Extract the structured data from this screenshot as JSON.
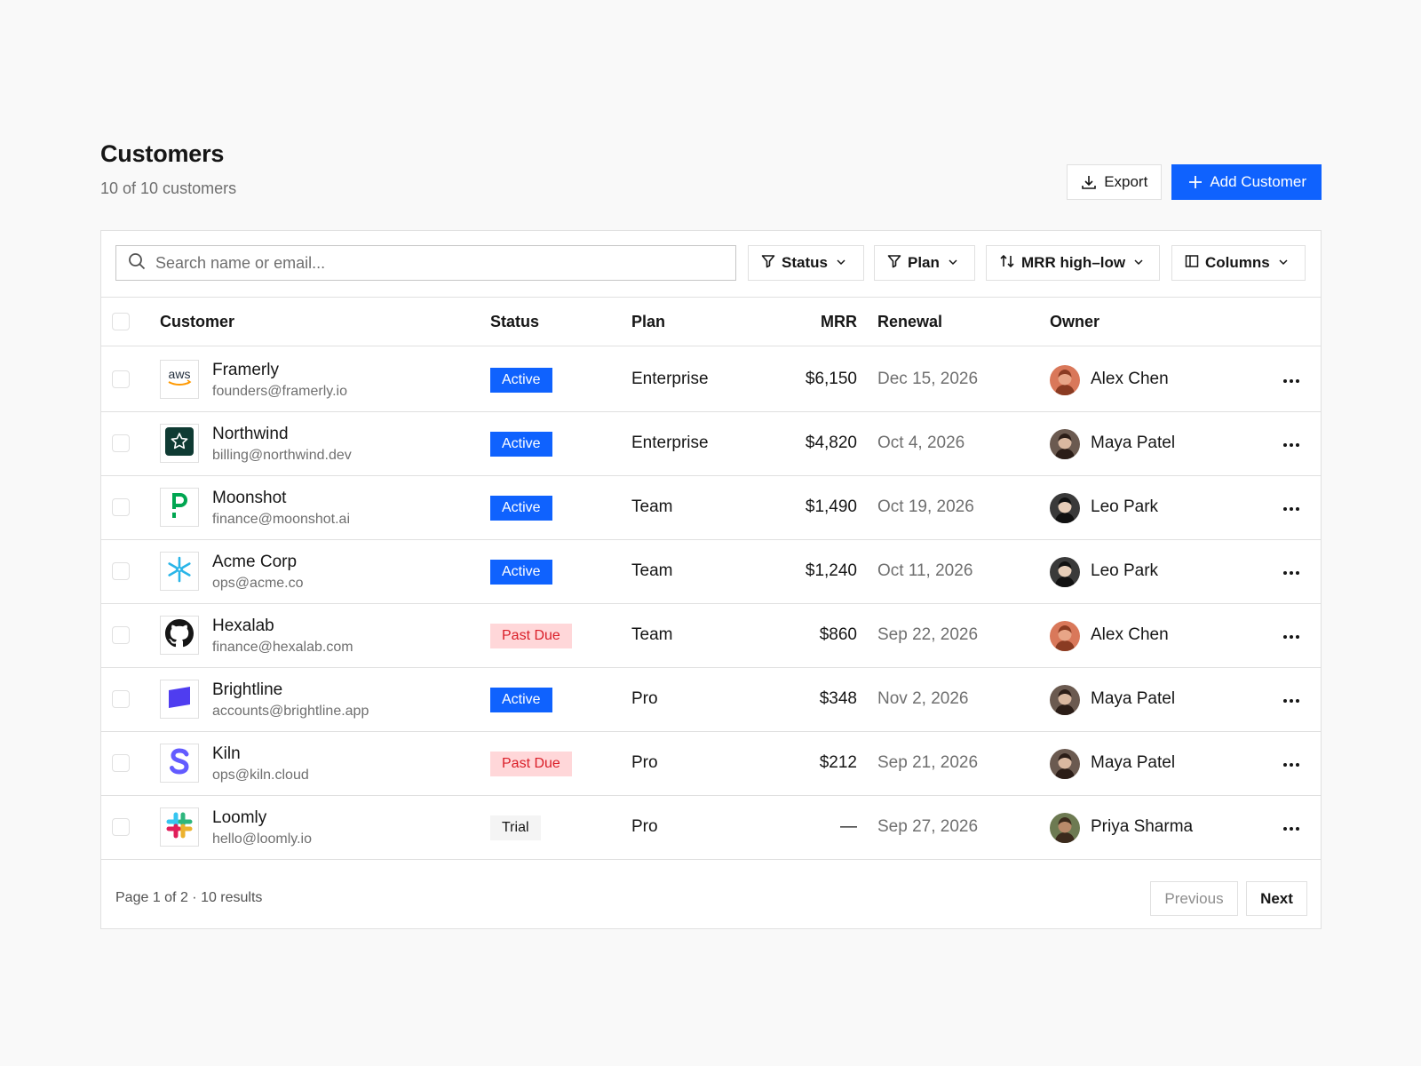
{
  "header": {
    "title": "Customers",
    "subtitle": "10 of 10 customers",
    "export_label": "Export",
    "add_label": "Add Customer"
  },
  "toolbar": {
    "search_placeholder": "Search name or email...",
    "filters": [
      {
        "label": "Status",
        "icon": "filter-icon"
      },
      {
        "label": "Plan",
        "icon": "filter-icon"
      },
      {
        "label": "MRR high–low",
        "icon": "sort-icon"
      },
      {
        "label": "Columns",
        "icon": "columns-icon"
      }
    ]
  },
  "table": {
    "columns": [
      "Customer",
      "Status",
      "Plan",
      "MRR",
      "Renewal",
      "Owner"
    ],
    "rows": [
      {
        "name": "Framerly",
        "email": "founders@framerly.io",
        "logo": "aws-logo",
        "status": "Active",
        "plan": "Enterprise",
        "mrr": "$6,150",
        "renewal": "Dec 15, 2026",
        "owner": "Alex Chen"
      },
      {
        "name": "Northwind",
        "email": "billing@northwind.dev",
        "logo": "star-logo",
        "status": "Active",
        "plan": "Enterprise",
        "mrr": "$4,820",
        "renewal": "Oct 4, 2026",
        "owner": "Maya Patel"
      },
      {
        "name": "Moonshot",
        "email": "finance@moonshot.ai",
        "logo": "p-logo",
        "status": "Active",
        "plan": "Team",
        "mrr": "$1,490",
        "renewal": "Oct 19, 2026",
        "owner": "Leo Park"
      },
      {
        "name": "Acme Corp",
        "email": "ops@acme.co",
        "logo": "snowflake-logo",
        "status": "Active",
        "plan": "Team",
        "mrr": "$1,240",
        "renewal": "Oct 11, 2026",
        "owner": "Leo Park"
      },
      {
        "name": "Hexalab",
        "email": "finance@hexalab.com",
        "logo": "github-logo",
        "status": "Past Due",
        "plan": "Team",
        "mrr": "$860",
        "renewal": "Sep 22, 2026",
        "owner": "Alex Chen"
      },
      {
        "name": "Brightline",
        "email": "accounts@brightline.app",
        "logo": "parallelogram-logo",
        "status": "Active",
        "plan": "Pro",
        "mrr": "$348",
        "renewal": "Nov 2, 2026",
        "owner": "Maya Patel"
      },
      {
        "name": "Kiln",
        "email": "ops@kiln.cloud",
        "logo": "s-logo",
        "status": "Past Due",
        "plan": "Pro",
        "mrr": "$212",
        "renewal": "Sep 21, 2026",
        "owner": "Maya Patel"
      },
      {
        "name": "Loomly",
        "email": "hello@loomly.io",
        "logo": "slack-logo",
        "status": "Trial",
        "plan": "Pro",
        "mrr": "—",
        "renewal": "Sep 27, 2026",
        "owner": "Priya Sharma"
      }
    ]
  },
  "footer": {
    "page_info": "Page 1 of 2 · 10 results",
    "previous_label": "Previous",
    "next_label": "Next"
  },
  "colors": {
    "accent": "#0f62fe",
    "active_bg": "#0f62fe",
    "past_due_bg": "#ffd7d9",
    "past_due_text": "#da1e28",
    "trial_bg": "#f4f4f4",
    "border": "#e0e0e0",
    "muted_text": "#6f6f6f"
  },
  "owners": {
    "Alex Chen": {
      "bg": "#d9785a",
      "skin": "#e8a587",
      "hair": "#8a3b22"
    },
    "Maya Patel": {
      "bg": "#6b5a50",
      "skin": "#d9b8a0",
      "hair": "#2b1d17"
    },
    "Leo Park": {
      "bg": "#3a3a3a",
      "skin": "#e6cdb8",
      "hair": "#111111"
    },
    "Priya Sharma": {
      "bg": "#6d7a52",
      "skin": "#b98a6a",
      "hair": "#3b2a1c"
    }
  }
}
